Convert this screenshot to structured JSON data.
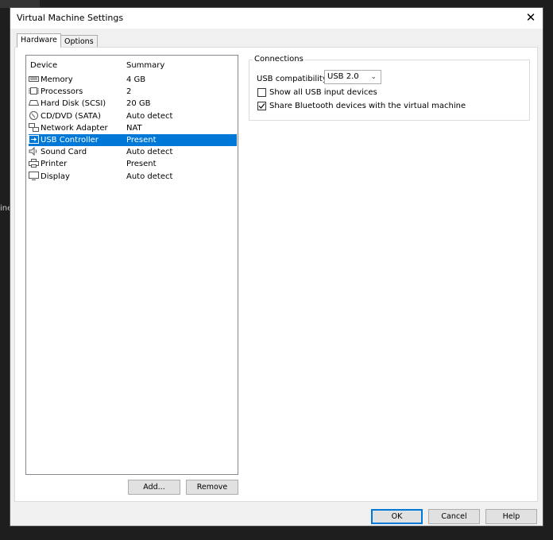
{
  "background": {
    "partial_text": "ine"
  },
  "window": {
    "title": "Virtual Machine Settings"
  },
  "tabs": [
    {
      "label": "Hardware",
      "active": true
    },
    {
      "label": "Options",
      "active": false
    }
  ],
  "device_list": {
    "headers": {
      "device": "Device",
      "summary": "Summary"
    },
    "rows": [
      {
        "icon": "memory-icon",
        "device": "Memory",
        "summary": "4 GB"
      },
      {
        "icon": "processor-icon",
        "device": "Processors",
        "summary": "2"
      },
      {
        "icon": "hard-disk-icon",
        "device": "Hard Disk (SCSI)",
        "summary": "20 GB"
      },
      {
        "icon": "cd-dvd-icon",
        "device": "CD/DVD (SATA)",
        "summary": "Auto detect"
      },
      {
        "icon": "network-adapter-icon",
        "device": "Network Adapter",
        "summary": "NAT"
      },
      {
        "icon": "usb-icon",
        "device": "USB Controller",
        "summary": "Present",
        "selected": true
      },
      {
        "icon": "sound-card-icon",
        "device": "Sound Card",
        "summary": "Auto detect"
      },
      {
        "icon": "printer-icon",
        "device": "Printer",
        "summary": "Present"
      },
      {
        "icon": "display-icon",
        "device": "Display",
        "summary": "Auto detect"
      }
    ],
    "add_label": "Add...",
    "remove_label": "Remove"
  },
  "connections": {
    "legend": "Connections",
    "usb_compat_label": "USB compatibility:",
    "usb_compat_value": "USB 2.0",
    "show_all_usb_label": "Show all USB input devices",
    "show_all_usb_checked": false,
    "share_bluetooth_label": "Share Bluetooth devices with the virtual machine",
    "share_bluetooth_checked": true
  },
  "footer": {
    "ok_label": "OK",
    "cancel_label": "Cancel",
    "help_label": "Help"
  },
  "colors": {
    "selection": "#0078d7",
    "dialog_bg": "#f0f0f0",
    "desktop_bg": "#1e1e1e"
  }
}
